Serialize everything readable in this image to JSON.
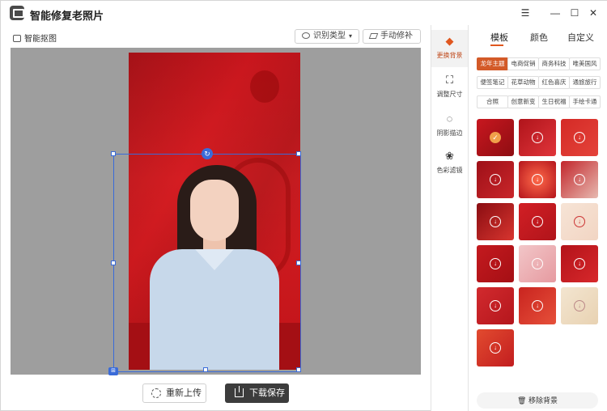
{
  "app": {
    "title": "智能修复老照片"
  },
  "window_controls": {
    "menu": "☰",
    "minimize": "—",
    "maximize": "☐",
    "close": "✕"
  },
  "toolbar": {
    "breadcrumb": "智能抠图",
    "recognize_label": "识别类型",
    "manual_label": "手动修补"
  },
  "actions": {
    "reupload": "重新上传",
    "download": "下载保存"
  },
  "tools": [
    {
      "label": "更换背景",
      "icon": "paint-bucket-icon"
    },
    {
      "label": "调整尺寸",
      "icon": "resize-icon"
    },
    {
      "label": "阴影描边",
      "icon": "shadow-circle-icon"
    },
    {
      "label": "色彩滤镜",
      "icon": "color-filter-icon"
    }
  ],
  "panel": {
    "tabs": [
      "模板",
      "颜色",
      "自定义"
    ],
    "tags": [
      [
        "龙年主题",
        "电商促销",
        "商务科技",
        "唯美国风"
      ],
      [
        "便签笔记",
        "花草动物",
        "红色喜庆",
        "通旅旅行"
      ],
      [
        "合照",
        "创意新变",
        "生日祝福",
        "手绘卡通"
      ]
    ],
    "remove_bg": "移除背景"
  },
  "colors": {
    "accent": "#e0571f",
    "selection": "#3a6bd8",
    "canvas_bg": "#9e9e9e",
    "photo_red": "#c8161d"
  }
}
